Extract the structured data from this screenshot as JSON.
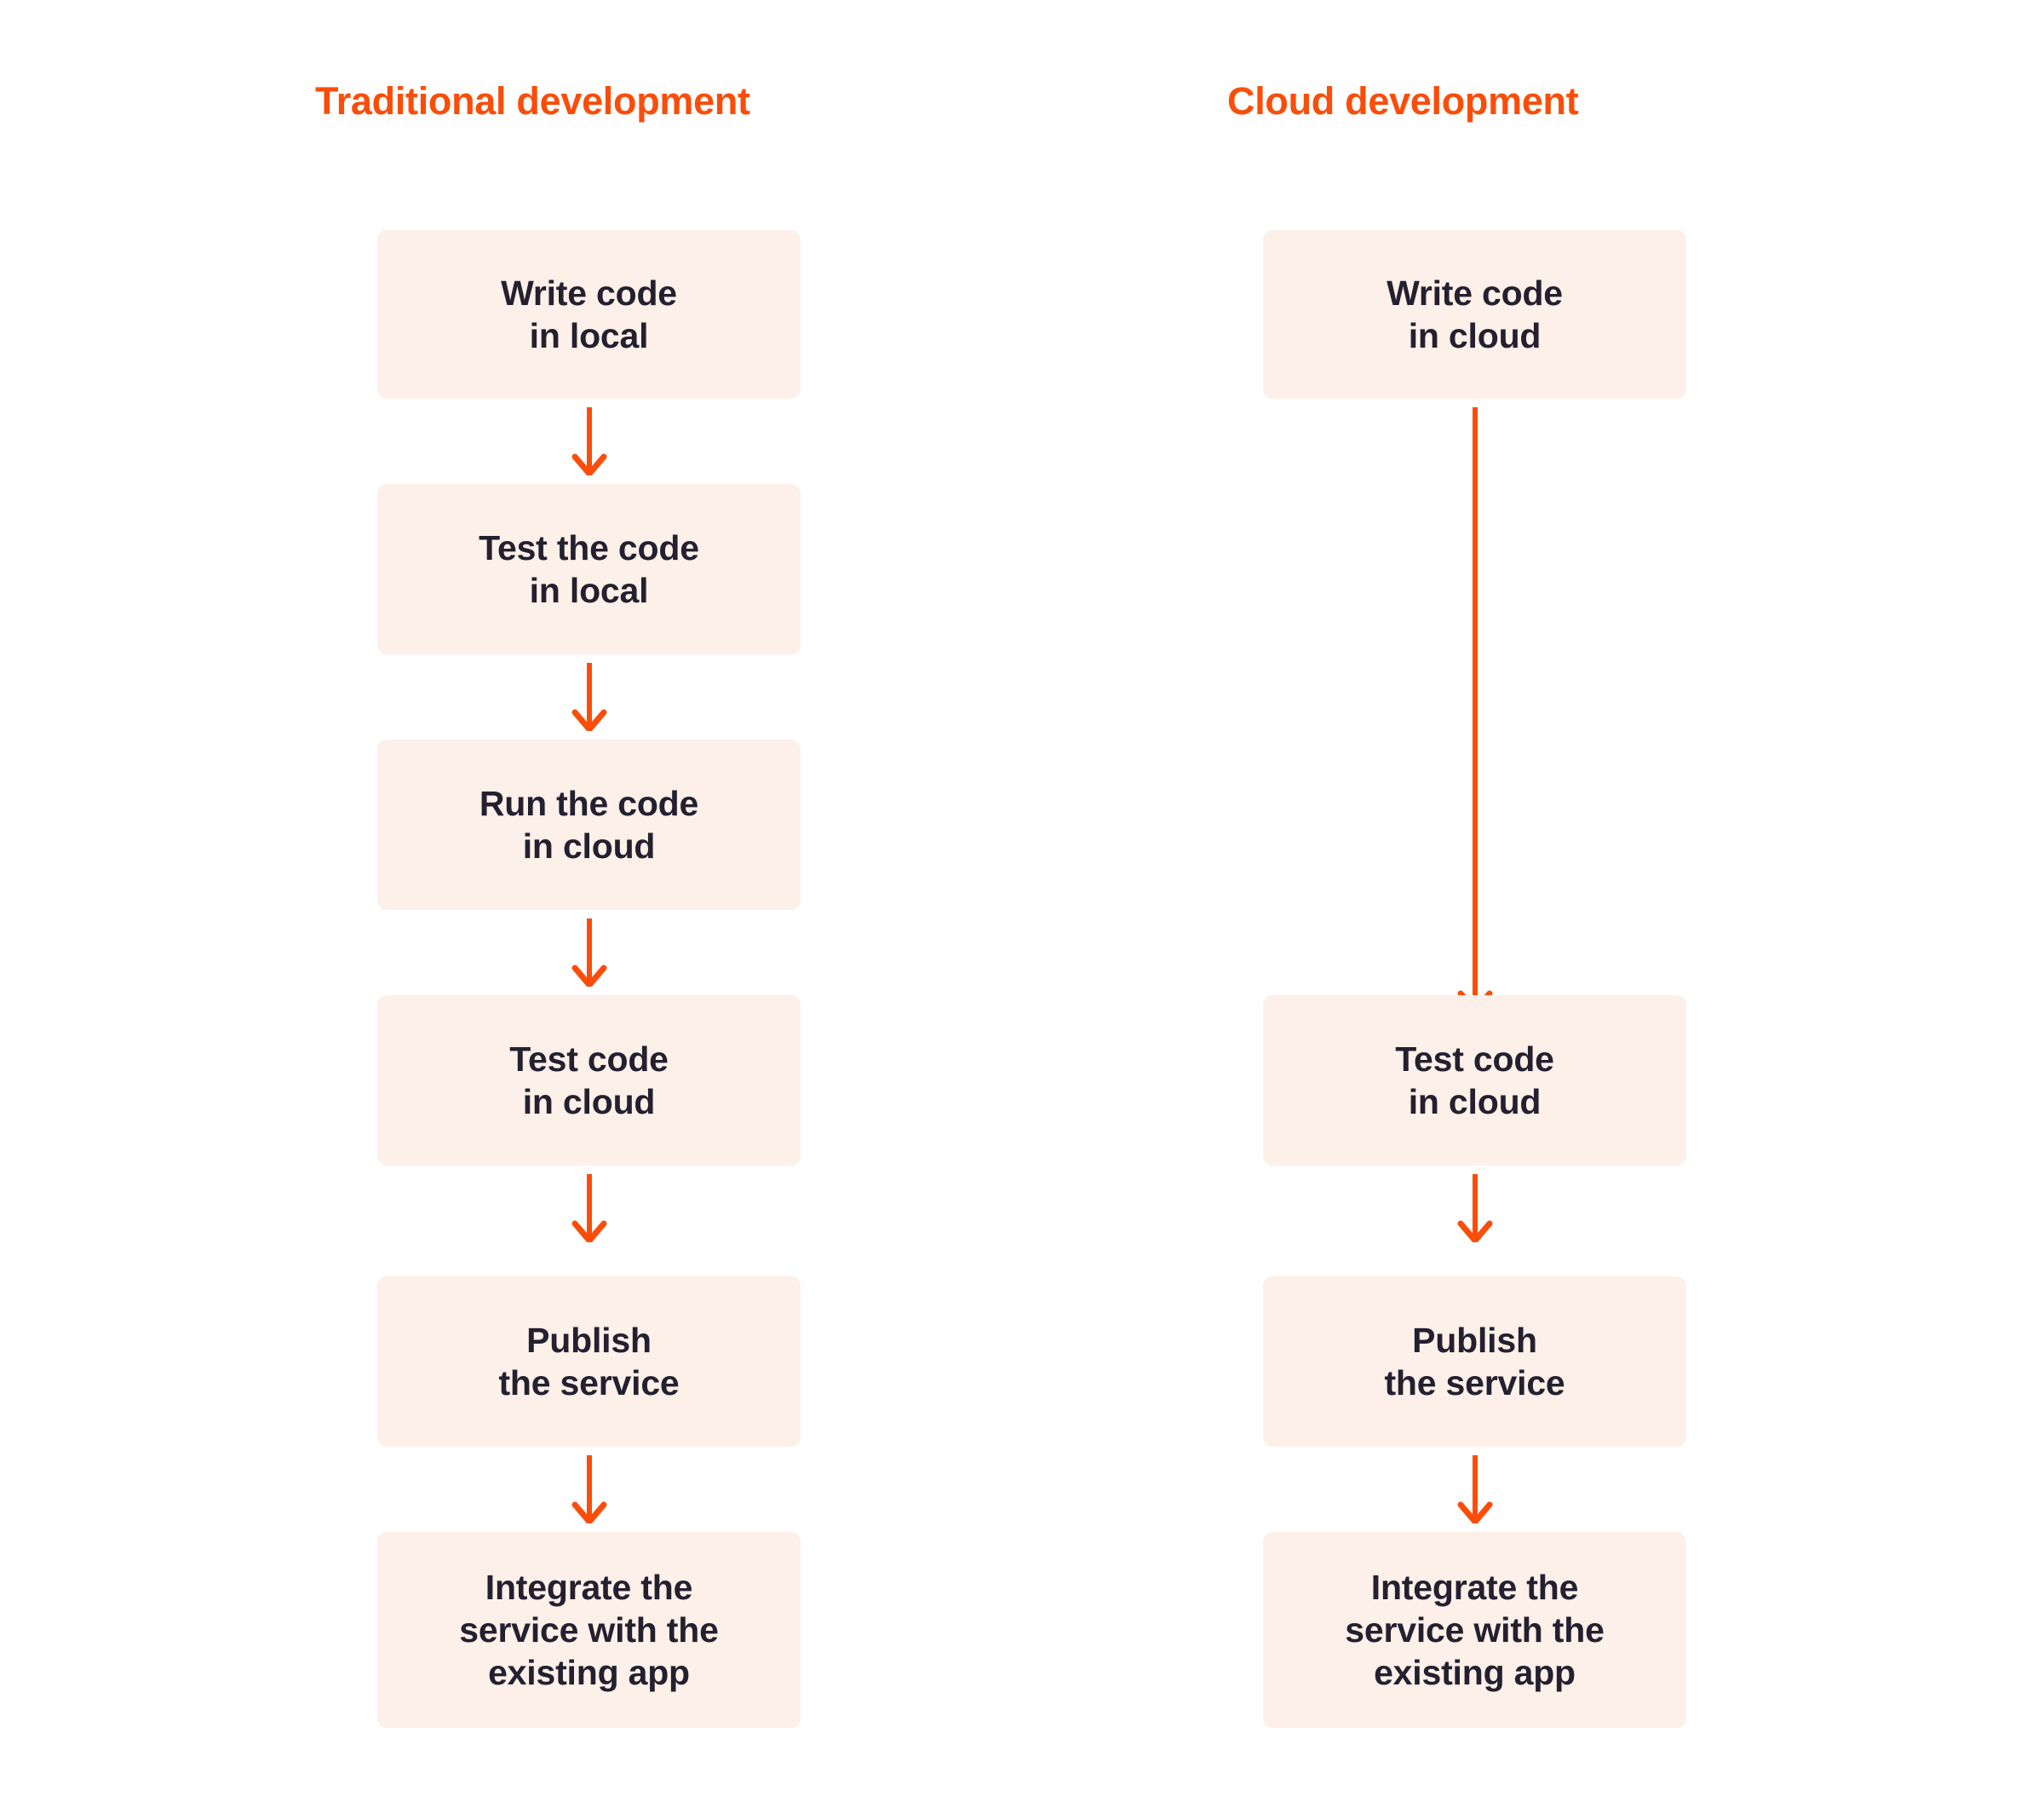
{
  "diagram": {
    "title_color": "#FA4D09",
    "box_color": "#FDF0E8",
    "text_color": "#232030",
    "arrow_color": "#FA4D09",
    "background_color": "#FFFFFF"
  },
  "columns": [
    {
      "id": "traditional",
      "title": "Traditional development",
      "steps": [
        {
          "label": "Write code\nin local"
        },
        {
          "label": "Test the code\nin local"
        },
        {
          "label": "Run the code\nin cloud"
        },
        {
          "label": "Test code\nin cloud"
        },
        {
          "label": "Publish\nthe service"
        },
        {
          "label": "Integrate the\nservice with the\nexisting app"
        }
      ],
      "connectors": [
        {
          "name": "arrow-write-to-test",
          "type": "arrow"
        },
        {
          "name": "arrow-test-to-run",
          "type": "arrow"
        },
        {
          "name": "arrow-run-to-testcloud",
          "type": "arrow"
        },
        {
          "name": "arrow-testcloud-to-publish",
          "type": "arrow"
        },
        {
          "name": "arrow-publish-to-integrate",
          "type": "arrow"
        }
      ]
    },
    {
      "id": "cloud",
      "title": "Cloud development",
      "steps": [
        {
          "label": "Write code\nin cloud"
        },
        {
          "label": "Test code\nin cloud"
        },
        {
          "label": "Publish\nthe service"
        },
        {
          "label": "Integrate the\nservice with the\nexisting app"
        }
      ],
      "connectors": [
        {
          "name": "arrow-write-to-testcloud-long",
          "type": "arrow-long"
        },
        {
          "name": "arrow-testcloud-to-publish",
          "type": "arrow"
        },
        {
          "name": "arrow-publish-to-integrate",
          "type": "arrow"
        }
      ]
    }
  ]
}
